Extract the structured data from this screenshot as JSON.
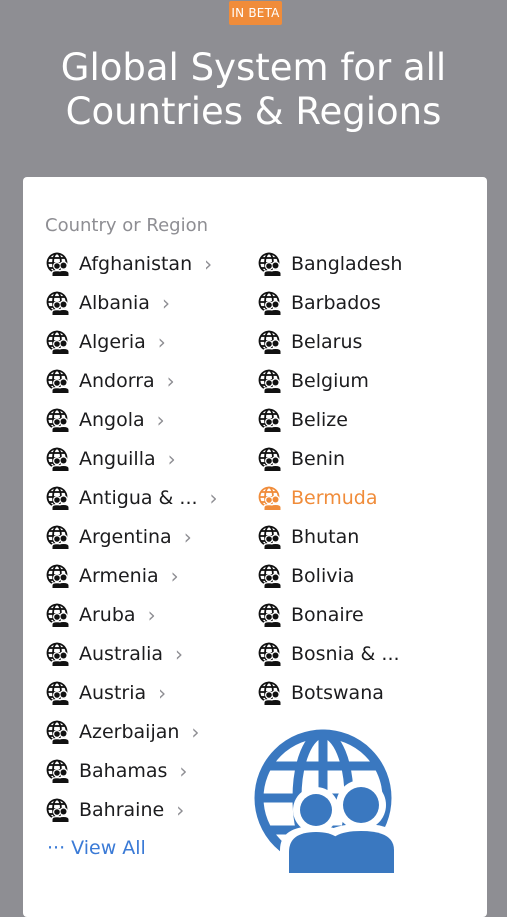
{
  "header": {
    "badge": "IN BETA",
    "title": "Global System for all\nCountries & Regions"
  },
  "card": {
    "section_label": "Country or Region",
    "left_items": [
      {
        "label": "Afghanistan",
        "icon": "globe-people-icon",
        "chevron": "›"
      },
      {
        "label": "Albania",
        "icon": "globe-people-icon",
        "chevron": "›"
      },
      {
        "label": "Algeria",
        "icon": "globe-people-icon",
        "chevron": "›"
      },
      {
        "label": "Andorra",
        "icon": "globe-people-icon",
        "chevron": "›"
      },
      {
        "label": "Angola",
        "icon": "globe-people-icon",
        "chevron": "›"
      },
      {
        "label": "Anguilla",
        "icon": "globe-people-icon",
        "chevron": "›"
      },
      {
        "label": "Antigua & ...",
        "icon": "globe-people-icon",
        "chevron": "›"
      },
      {
        "label": "Argentina",
        "icon": "globe-people-icon",
        "chevron": "›"
      },
      {
        "label": "Armenia",
        "icon": "globe-people-icon",
        "chevron": "›"
      },
      {
        "label": "Aruba",
        "icon": "globe-people-icon",
        "chevron": "›"
      },
      {
        "label": "Australia",
        "icon": "globe-people-icon",
        "chevron": "›"
      },
      {
        "label": "Austria",
        "icon": "globe-people-icon",
        "chevron": "›"
      },
      {
        "label": "Azerbaijan",
        "icon": "globe-people-icon",
        "chevron": "›"
      },
      {
        "label": "Bahamas",
        "icon": "globe-people-icon",
        "chevron": "›"
      },
      {
        "label": "Bahraine",
        "icon": "globe-people-icon",
        "chevron": "›"
      }
    ],
    "right_items": [
      {
        "label": "Bangladesh",
        "icon": "globe-people-icon"
      },
      {
        "label": "Barbados",
        "icon": "globe-people-icon"
      },
      {
        "label": "Belarus",
        "icon": "globe-people-icon"
      },
      {
        "label": "Belgium",
        "icon": "globe-people-icon"
      },
      {
        "label": "Belize",
        "icon": "globe-people-icon"
      },
      {
        "label": "Benin",
        "icon": "globe-people-icon"
      },
      {
        "label": "Bermuda",
        "icon": "globe-people-icon",
        "active": true
      },
      {
        "label": "Bhutan",
        "icon": "globe-people-icon"
      },
      {
        "label": "Bolivia",
        "icon": "globe-people-icon"
      },
      {
        "label": "Bonaire",
        "icon": "globe-people-icon"
      },
      {
        "label": "Bosnia & ...",
        "icon": "globe-people-icon"
      },
      {
        "label": "Botswana",
        "icon": "globe-people-icon"
      }
    ],
    "view_all": "··· View All",
    "illustration_icon": "globe-people-icon"
  },
  "colors": {
    "background": "#8e8e93",
    "accent_orange": "#f08c3a",
    "link_blue": "#3a7ad6",
    "illustration_blue": "#3a78c0",
    "text_dark": "#1c1c1e",
    "text_muted": "#8e8e93"
  }
}
